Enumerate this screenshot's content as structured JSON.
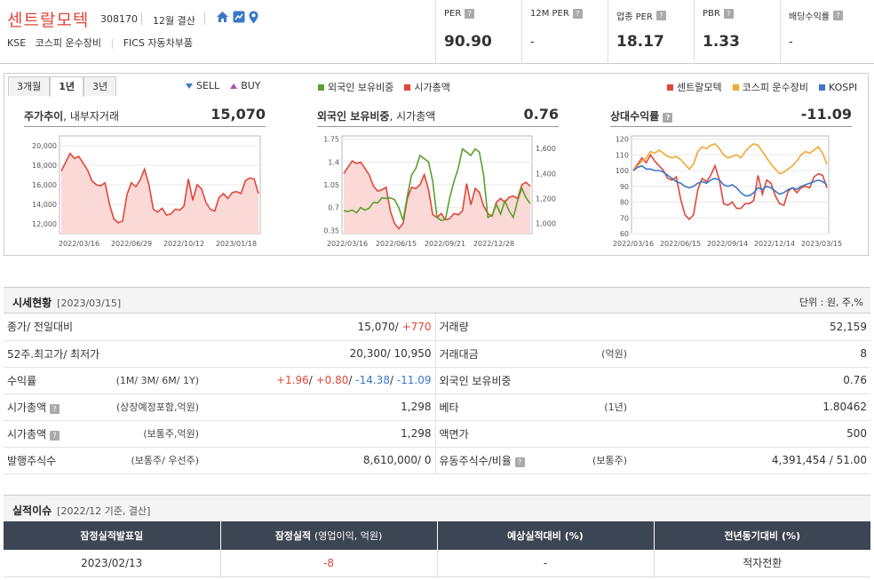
{
  "header": {
    "company_name": "센트랄모텍",
    "code": "308170",
    "settlement": "12월 결산",
    "market": "KSE",
    "sector_kospi": "코스피 운수장비",
    "sector_fics": "FICS 자동차부품",
    "icons": [
      "home-icon",
      "chart-icon",
      "location-icon"
    ]
  },
  "metrics": [
    {
      "label": "PER",
      "value": "90.90"
    },
    {
      "label": "12M PER",
      "value": "-"
    },
    {
      "label": "업종 PER",
      "value": "18.17"
    },
    {
      "label": "PBR",
      "value": "1.33"
    },
    {
      "label": "배당수익률",
      "value": "-"
    }
  ],
  "chart_panel": {
    "tabs": [
      "3개월",
      "1년",
      "3년"
    ],
    "active_tab": "1년",
    "sell_label": "SELL",
    "buy_label": "BUY",
    "mid_legend": [
      {
        "name": "외국인 보유비중",
        "color": "#5aa02c"
      },
      {
        "name": "시가총액",
        "color": "#e0463a"
      }
    ],
    "right_legend": [
      {
        "name": "센트랄모텍",
        "color": "#e0463a"
      },
      {
        "name": "코스피 운수장비",
        "color": "#f0a830"
      },
      {
        "name": "KOSPI",
        "color": "#3a78c8"
      }
    ]
  },
  "chart_data": [
    {
      "type": "area",
      "title": "주가추이",
      "subtitle": "내부자거래",
      "value": "15,070",
      "x_ticks": [
        "2022/03/16",
        "2022/06/29",
        "2022/10/12",
        "2023/01/18"
      ],
      "y_ticks": [
        "20,000",
        "18,000",
        "16,000",
        "14,000",
        "12,000"
      ],
      "ylim": [
        11000,
        21000
      ],
      "series": [
        {
          "color": "#e0463a",
          "values": [
            17400,
            18300,
            19200,
            18700,
            18900,
            18200,
            17500,
            16400,
            16000,
            15900,
            16200,
            14000,
            12500,
            12100,
            12300,
            15000,
            16200,
            15800,
            16500,
            17600,
            16000,
            13500,
            13200,
            13600,
            12900,
            13000,
            13500,
            13400,
            13800,
            16600,
            14400,
            16000,
            15600,
            14200,
            13500,
            13300,
            14700,
            15100,
            14600,
            15200,
            15300,
            15100,
            16400,
            16700,
            16600,
            15070
          ]
        }
      ]
    },
    {
      "type": "line",
      "title": "외국인 보유비중",
      "subtitle": "시가총액",
      "value": "0.76",
      "x_ticks": [
        "2022/03/16",
        "2022/06/15",
        "2022/09/21",
        "2022/12/28"
      ],
      "y_ticks_left": [
        "1.75",
        "1.4",
        "1.05",
        "0.7",
        "0.35"
      ],
      "y_ticks_right": [
        "1,600",
        "1,400",
        "1,200",
        "1,000"
      ],
      "ylim_left": [
        0.3,
        1.8
      ],
      "ylim_right": [
        920,
        1700
      ],
      "series": [
        {
          "name": "외국인 보유비중",
          "color": "#5aa02c",
          "values": [
            0.65,
            0.64,
            0.66,
            0.62,
            0.7,
            0.66,
            0.69,
            0.78,
            0.77,
            0.85,
            0.84,
            0.85,
            0.82,
            0.7,
            0.5,
            0.88,
            1.2,
            1.3,
            1.5,
            1.45,
            1.4,
            1.1,
            0.55,
            0.5,
            0.52,
            0.85,
            1.1,
            1.3,
            1.6,
            1.55,
            1.5,
            1.6,
            1.55,
            1.2,
            0.55,
            0.58,
            0.75,
            0.6,
            0.8,
            0.65,
            0.55,
            0.8,
            1.0,
            0.85,
            0.76
          ]
        },
        {
          "name": "시가총액",
          "color": "#e0463a",
          "values": [
            1400,
            1450,
            1500,
            1480,
            1490,
            1440,
            1390,
            1300,
            1260,
            1270,
            1290,
            1100,
            1000,
            960,
            1000,
            1200,
            1290,
            1280,
            1310,
            1390,
            1270,
            1070,
            1050,
            1080,
            1030,
            1040,
            1080,
            1070,
            1100,
            1320,
            1150,
            1280,
            1250,
            1140,
            1080,
            1060,
            1170,
            1200,
            1170,
            1210,
            1220,
            1200,
            1310,
            1330,
            1298
          ]
        }
      ]
    },
    {
      "type": "line",
      "title": "상대수익률",
      "value": "-11.09",
      "x_ticks": [
        "2022/03/16",
        "2022/06/15",
        "2022/09/14",
        "2022/12/14",
        "2023/03/15"
      ],
      "y_ticks": [
        "120",
        "110",
        "100",
        "90",
        "80",
        "70",
        "60"
      ],
      "ylim": [
        60,
        122
      ],
      "series": [
        {
          "name": "센트랄모텍",
          "color": "#e0463a",
          "values": [
            100,
            104,
            108,
            105,
            110,
            106,
            103,
            100,
            95,
            94,
            96,
            82,
            72,
            69,
            72,
            88,
            95,
            93,
            97,
            103,
            94,
            79,
            78,
            80,
            76,
            76,
            79,
            79,
            81,
            97,
            85,
            94,
            92,
            84,
            79,
            78,
            87,
            89,
            86,
            89,
            90,
            89,
            96,
            98,
            97,
            89
          ]
        },
        {
          "name": "코스피 운수장비",
          "color": "#f0a830",
          "values": [
            100,
            103,
            106,
            108,
            112,
            111,
            113,
            111,
            109,
            108,
            109,
            107,
            104,
            101,
            104,
            112,
            115,
            114,
            116,
            117,
            114,
            110,
            108,
            109,
            110,
            108,
            112,
            115,
            117,
            116,
            112,
            108,
            104,
            101,
            98,
            99,
            101,
            103,
            106,
            110,
            112,
            111,
            113,
            115,
            111,
            104
          ]
        },
        {
          "name": "KOSPI",
          "color": "#3a78c8",
          "values": [
            100,
            102,
            103,
            101,
            101,
            100,
            100,
            99,
            97,
            95,
            93,
            92,
            90,
            89,
            90,
            92,
            93,
            92,
            94,
            95,
            94,
            91,
            90,
            91,
            89,
            86,
            84,
            84,
            86,
            89,
            88,
            90,
            89,
            87,
            85,
            86,
            88,
            89,
            88,
            90,
            91,
            92,
            93,
            94,
            93,
            91
          ]
        }
      ]
    }
  ],
  "quote_section": {
    "title": "시세현황",
    "date": "[2023/03/15]",
    "unit": "단위 : 원, 주,%",
    "rows": [
      {
        "k1": "종가/ 전일대비",
        "p1": "",
        "v1a": "15,070/ ",
        "v1b": "+770",
        "k2": "거래량",
        "p2": "",
        "v2": "52,159"
      },
      {
        "k1": "52주.최고가/ 최저가",
        "p1": "",
        "v1a": "20,300/ 10,950",
        "v1b": "",
        "k2": "거래대금",
        "p2": "(억원)",
        "v2": "8"
      },
      {
        "k1": "수익률",
        "p1": "(1M/ 3M/ 6M/ 1Y)",
        "v1a": "",
        "v1b": "",
        "k2": "외국인 보유비중",
        "p2": "",
        "v2": "0.76"
      },
      {
        "k1": "시가총액",
        "p1": "(상장예정포함,억원)",
        "v1a": "1,298",
        "v1b": "",
        "k2": "베타",
        "p2": "(1년)",
        "v2": "1.80462"
      },
      {
        "k1": "시가총액",
        "p1": "(보통주,억원)",
        "v1a": "1,298",
        "v1b": "",
        "k2": "액면가",
        "p2": "",
        "v2": "500"
      },
      {
        "k1": "발행주식수",
        "p1": "(보통주/ 우선주)",
        "v1a": "8,610,000/ 0",
        "v1b": "",
        "k2": "유동주식수/비율",
        "p2": "(보통주)",
        "v2": "4,391,454 / 51.00"
      }
    ],
    "returns": {
      "m1": "+1.96",
      "m3": "+0.80",
      "m6": "-14.38",
      "y1": "-11.09",
      "sep": "/ "
    }
  },
  "issue_section": {
    "title": "실적이슈",
    "date": "[2022/12 기준, 결산]",
    "headers": [
      "잠정실적발표일",
      "잠정실적",
      "(영업이익, 억원)",
      "예상실적대비 (%)",
      "전년동기대비 (%)"
    ],
    "row": [
      "2023/02/13",
      "-8",
      "-",
      "적자전환"
    ]
  }
}
